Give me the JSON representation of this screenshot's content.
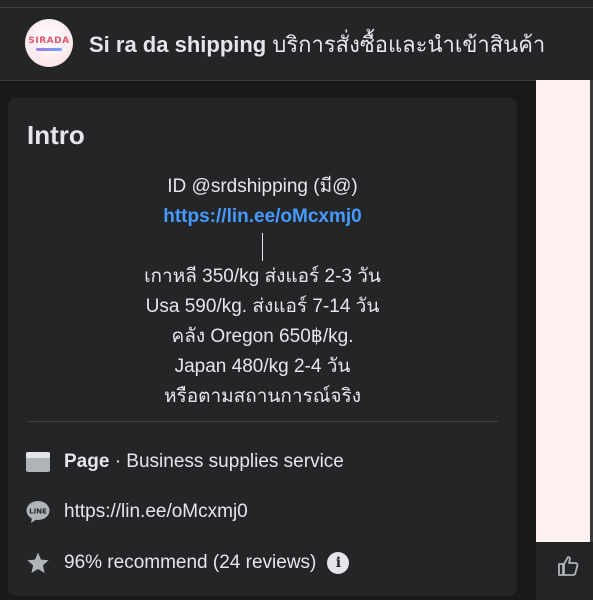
{
  "header": {
    "avatar_text": "SIRADA",
    "title_name": "Si ra da shipping",
    "title_thai": "บริการสั่งซื้อและนำเข้าสินค้า"
  },
  "intro": {
    "heading": "Intro",
    "bio_id": "ID @srdshipping (มี@)",
    "bio_link": "https://lin.ee/oMcxmj0",
    "bio_lines": [
      "เกาหลี 350/kg ส่งแอร์ 2-3 วัน",
      "Usa 590/kg. ส่งแอร์ 7-14 วัน",
      "คลัง Oregon 650฿/kg.",
      "Japan 480/kg 2-4 วัน",
      "หรือตามสถานการณ์จริง"
    ],
    "page_label": "Page",
    "page_category": " · Business supplies service",
    "line_link": "https://lin.ee/oMcxmj0",
    "recommend": "96% recommend (24 reviews)",
    "info_glyph": "i"
  },
  "icons": {
    "page": "page-icon",
    "line": "line-app-icon",
    "star": "star-icon",
    "info": "info-icon",
    "like": "like-icon"
  },
  "colors": {
    "background": "#18191a",
    "card": "#242526",
    "text": "#e4e6eb",
    "link": "#4599ff",
    "avatar_brand": "#e0566e"
  }
}
